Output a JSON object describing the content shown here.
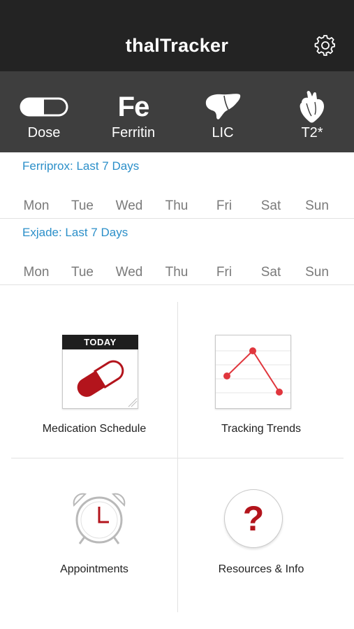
{
  "header": {
    "title": "thalTracker",
    "settings_icon": "gear-icon"
  },
  "tabs": [
    {
      "id": "dose",
      "label": "Dose",
      "icon": "toggle-capsule-icon"
    },
    {
      "id": "ferritin",
      "label": "Ferritin",
      "icon_text": "Fe"
    },
    {
      "id": "lic",
      "label": "LIC",
      "icon": "liver-icon"
    },
    {
      "id": "t2",
      "label": "T2*",
      "icon": "heart-icon"
    }
  ],
  "weeks": [
    {
      "title": "Ferriprox: Last 7 Days",
      "days": [
        "Mon",
        "Tue",
        "Wed",
        "Thu",
        "Fri",
        "Sat",
        "Sun"
      ]
    },
    {
      "title": "Exjade: Last 7 Days",
      "days": [
        "Mon",
        "Tue",
        "Wed",
        "Thu",
        "Fri",
        "Sat",
        "Sun"
      ]
    }
  ],
  "tiles": {
    "medication": {
      "label": "Medication Schedule",
      "badge": "TODAY",
      "icon": "pill-calendar-icon"
    },
    "trends": {
      "label": "Tracking Trends",
      "icon": "line-chart-icon"
    },
    "appointments": {
      "label": "Appointments",
      "icon": "alarm-clock-icon"
    },
    "resources": {
      "label": "Resources & Info",
      "icon_text": "?",
      "icon": "question-icon"
    }
  },
  "colors": {
    "header_bg": "#232323",
    "tabbar_bg": "#3e3e3e",
    "link_blue": "#2b8fc9",
    "accent_red": "#b3141c"
  }
}
